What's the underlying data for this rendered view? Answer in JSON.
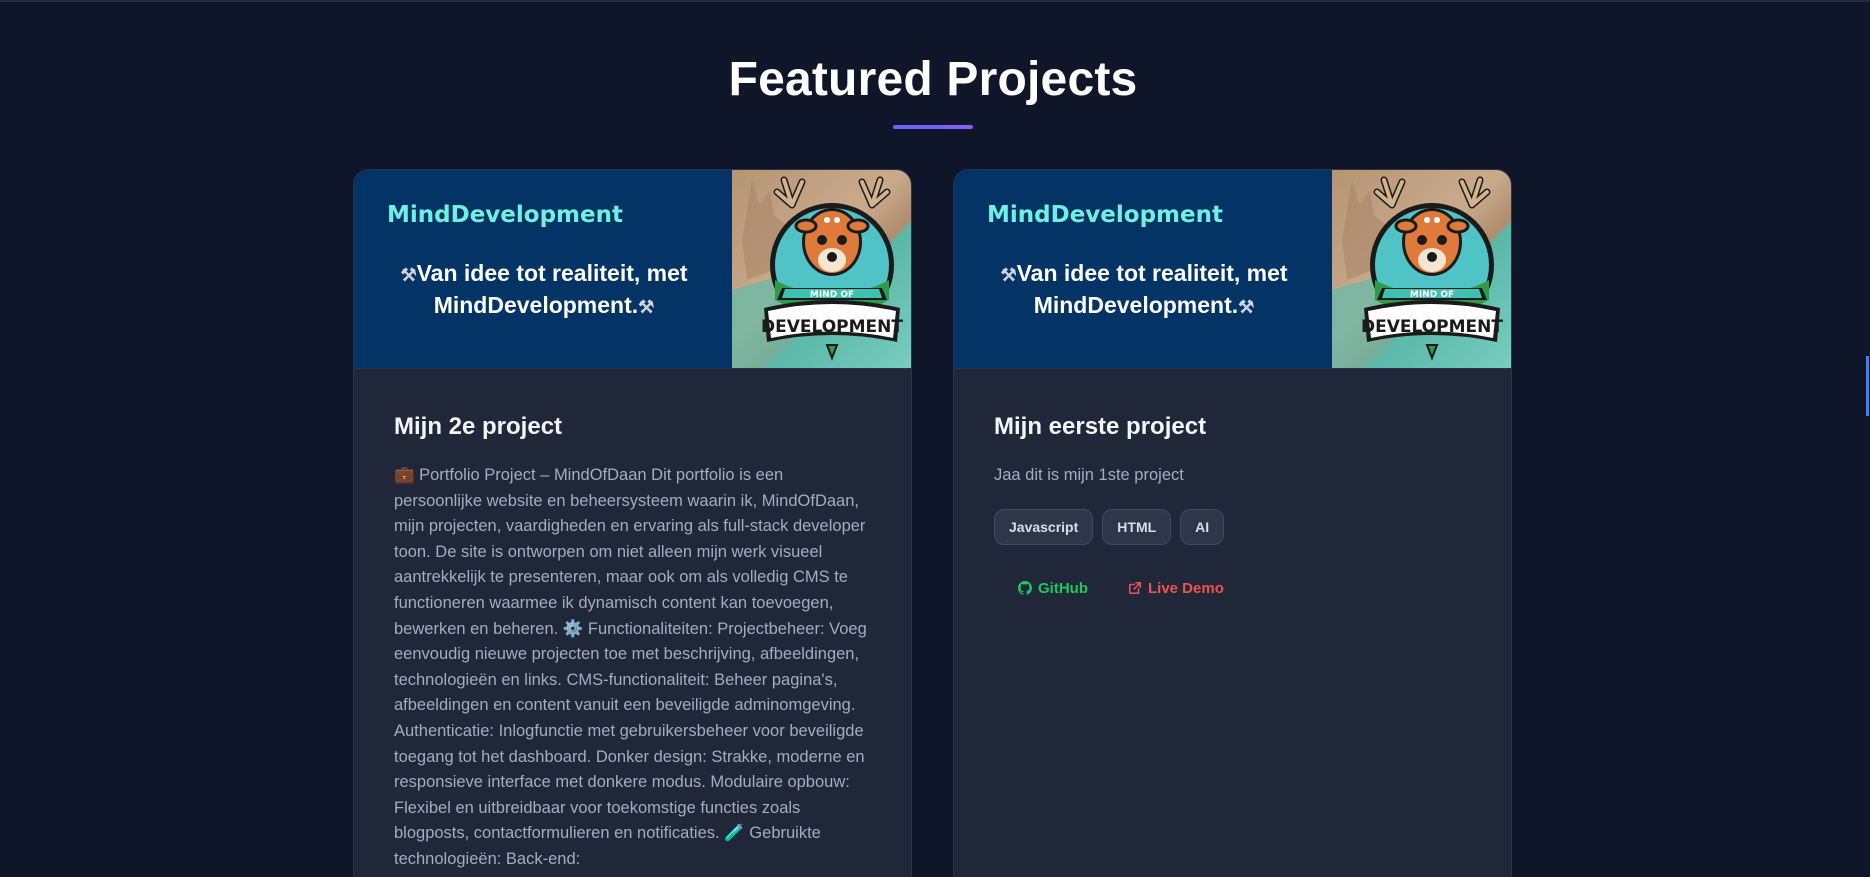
{
  "section": {
    "title": "Featured Projects"
  },
  "projects": [
    {
      "banner": {
        "brand": "MindDevelopment",
        "tagline": "Van idee tot realiteit, met MindDevelopment.",
        "logo_text_top": "MIND OF",
        "logo_text_bottom": "DEVELOPMENT"
      },
      "title": "Mijn 2e project",
      "description": "💼 Portfolio Project – MindOfDaan Dit portfolio is een persoonlijke website en beheersysteem waarin ik, MindOfDaan, mijn projecten, vaardigheden en ervaring als full-stack developer toon. De site is ontworpen om niet alleen mijn werk visueel aantrekkelijk te presenteren, maar ook om als volledig CMS te functioneren waarmee ik dynamisch content kan toevoegen, bewerken en beheren. ⚙️ Functionaliteiten: Projectbeheer: Voeg eenvoudig nieuwe projecten toe met beschrijving, afbeeldingen, technologieën en links. CMS-functionaliteit: Beheer pagina's, afbeeldingen en content vanuit een beveiligde adminomgeving. Authenticatie: Inlogfunctie met gebruikersbeheer voor beveiligde toegang tot het dashboard. Donker design: Strakke, moderne en responsieve interface met donkere modus. Modulaire opbouw: Flexibel en uitbreidbaar voor toekomstige functies zoals blogposts, contactformulieren en notificaties. 🧪 Gebruikte technologieën: Back-end:"
    },
    {
      "banner": {
        "brand": "MindDevelopment",
        "tagline": "Van idee tot realiteit, met MindDevelopment.",
        "logo_text_top": "MIND OF",
        "logo_text_bottom": "DEVELOPMENT"
      },
      "title": "Mijn eerste project",
      "description": "Jaa dit is mijn 1ste project",
      "tags": [
        "Javascript",
        "HTML",
        "AI"
      ],
      "links": {
        "github": "GitHub",
        "demo": "Live Demo"
      }
    }
  ],
  "colors": {
    "background": "#0f1629",
    "card": "#1f2739",
    "banner": "#043366",
    "brand_text": "#6ff0e0",
    "accent_gradient_start": "#6366f1",
    "accent_gradient_end": "#8b5cf6",
    "github_link": "#22c55e",
    "demo_link": "#f05252"
  },
  "icons": {
    "tool": "hammer-wrench-icon",
    "github": "github-icon",
    "external": "external-link-icon"
  }
}
